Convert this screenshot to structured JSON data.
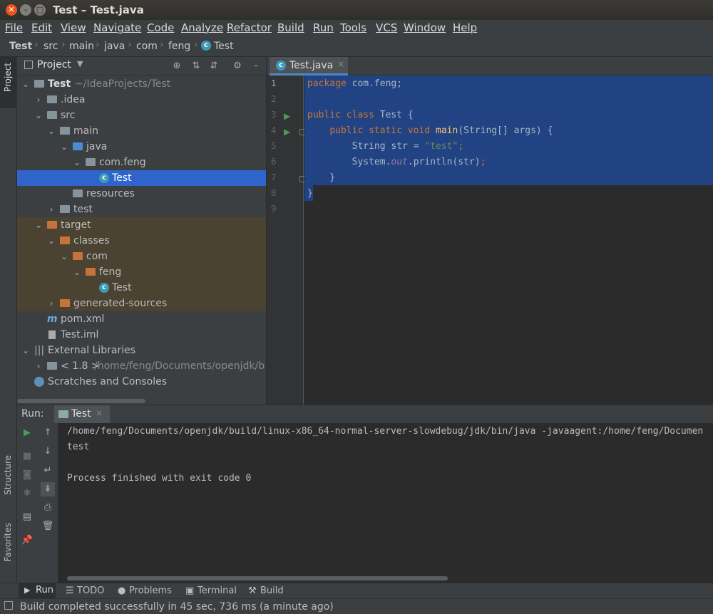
{
  "window": {
    "title": "Test – Test.java"
  },
  "menu": [
    "File",
    "Edit",
    "View",
    "Navigate",
    "Code",
    "Analyze",
    "Refactor",
    "Build",
    "Run",
    "Tools",
    "VCS",
    "Window",
    "Help"
  ],
  "breadcrumbs": [
    "Test",
    "src",
    "main",
    "java",
    "com",
    "feng",
    "Test"
  ],
  "left_strip": {
    "project": "Project",
    "structure": "Structure",
    "favorites": "Favorites"
  },
  "project_panel": {
    "title": "Project",
    "tree": [
      {
        "label": "Test",
        "hint": "~/IdeaProjects/Test",
        "icon": "module-folder-icon"
      },
      {
        "label": ".idea",
        "icon": "folder-icon"
      },
      {
        "label": "src",
        "icon": "folder-icon"
      },
      {
        "label": "main",
        "icon": "folder-icon"
      },
      {
        "label": "java",
        "icon": "source-folder-icon"
      },
      {
        "label": "com.feng",
        "icon": "package-icon"
      },
      {
        "label": "Test",
        "icon": "class-icon"
      },
      {
        "label": "resources",
        "icon": "resources-folder-icon"
      },
      {
        "label": "test",
        "icon": "folder-icon"
      },
      {
        "label": "target",
        "icon": "excluded-folder-icon"
      },
      {
        "label": "classes",
        "icon": "excluded-folder-icon"
      },
      {
        "label": "com",
        "icon": "excluded-folder-icon"
      },
      {
        "label": "feng",
        "icon": "excluded-folder-icon"
      },
      {
        "label": "Test",
        "icon": "class-icon"
      },
      {
        "label": "generated-sources",
        "icon": "excluded-folder-icon"
      },
      {
        "label": "pom.xml",
        "icon": "maven-icon"
      },
      {
        "label": "Test.iml",
        "icon": "iml-file-icon"
      },
      {
        "label": "External Libraries",
        "icon": "libraries-icon"
      },
      {
        "label": "< 1.8 >",
        "hint": "/home/feng/Documents/openjdk/b",
        "icon": "jdk-icon"
      },
      {
        "label": "Scratches and Consoles",
        "icon": "scratches-icon"
      }
    ]
  },
  "editor": {
    "tab": "Test.java",
    "line_numbers": [
      "1",
      "2",
      "3",
      "4",
      "5",
      "6",
      "7",
      "8",
      "9"
    ]
  },
  "run_panel": {
    "label": "Run:",
    "tab": "Test",
    "console": [
      "/home/feng/Documents/openjdk/build/linux-x86_64-normal-server-slowdebug/jdk/bin/java -javaagent:/home/feng/Documen",
      "test",
      "",
      "Process finished with exit code 0"
    ]
  },
  "bottom_tools": [
    "Run",
    "TODO",
    "Problems",
    "Terminal",
    "Build"
  ],
  "status": "Build completed successfully in 45 sec, 736 ms (a minute ago)",
  "colors": {
    "selection": "#2f65ca",
    "code_selection": "#214283",
    "keyword": "#cc7832",
    "string": "#6a8759",
    "method": "#ffc66d"
  }
}
